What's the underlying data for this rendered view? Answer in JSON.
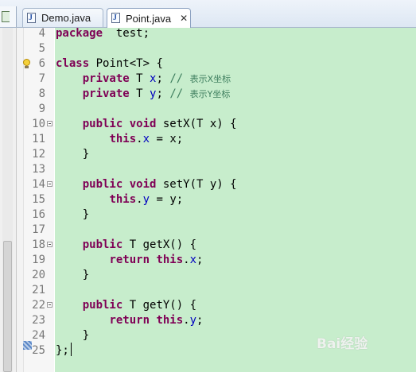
{
  "tabs": [
    {
      "label": "Demo.java",
      "icon": "java-file-icon",
      "active": false
    },
    {
      "label": "Point.java",
      "icon": "java-file-icon",
      "active": true,
      "close": "✕"
    }
  ],
  "editor": {
    "background": "#c7edcc",
    "lines": [
      {
        "num": "4",
        "code": [
          [
            "kw",
            "package"
          ],
          [
            "",
            "  test;"
          ]
        ]
      },
      {
        "num": "5",
        "code": []
      },
      {
        "num": "6",
        "code": [
          [
            "kw",
            "class"
          ],
          [
            "",
            " Point<T> {"
          ]
        ],
        "marker": "warning-bulb-icon"
      },
      {
        "num": "7",
        "code": [
          [
            "",
            "    "
          ],
          [
            "kw",
            "private"
          ],
          [
            "",
            " T "
          ],
          [
            "fld",
            "x"
          ],
          [
            "",
            "; "
          ],
          [
            "cm",
            "// "
          ],
          [
            "cmcn",
            "表示X坐标"
          ]
        ]
      },
      {
        "num": "8",
        "code": [
          [
            "",
            "    "
          ],
          [
            "kw",
            "private"
          ],
          [
            "",
            " T "
          ],
          [
            "fld",
            "y"
          ],
          [
            "",
            "; "
          ],
          [
            "cm",
            "// "
          ],
          [
            "cmcn",
            "表示Y坐标"
          ]
        ]
      },
      {
        "num": "9",
        "code": []
      },
      {
        "num": "10",
        "code": [
          [
            "",
            "    "
          ],
          [
            "kw",
            "public"
          ],
          [
            "",
            " "
          ],
          [
            "kw",
            "void"
          ],
          [
            "",
            " setX(T x) {"
          ]
        ],
        "fold": true
      },
      {
        "num": "11",
        "code": [
          [
            "",
            "        "
          ],
          [
            "kw",
            "this"
          ],
          [
            "",
            "."
          ],
          [
            "fld",
            "x"
          ],
          [
            "",
            " = x;"
          ]
        ]
      },
      {
        "num": "12",
        "code": [
          [
            "",
            "    }"
          ]
        ]
      },
      {
        "num": "13",
        "code": []
      },
      {
        "num": "14",
        "code": [
          [
            "",
            "    "
          ],
          [
            "kw",
            "public"
          ],
          [
            "",
            " "
          ],
          [
            "kw",
            "void"
          ],
          [
            "",
            " setY(T y) {"
          ]
        ],
        "fold": true
      },
      {
        "num": "15",
        "code": [
          [
            "",
            "        "
          ],
          [
            "kw",
            "this"
          ],
          [
            "",
            "."
          ],
          [
            "fld",
            "y"
          ],
          [
            "",
            " = y;"
          ]
        ]
      },
      {
        "num": "16",
        "code": [
          [
            "",
            "    }"
          ]
        ]
      },
      {
        "num": "17",
        "code": []
      },
      {
        "num": "18",
        "code": [
          [
            "",
            "    "
          ],
          [
            "kw",
            "public"
          ],
          [
            "",
            " T getX() {"
          ]
        ],
        "fold": true
      },
      {
        "num": "19",
        "code": [
          [
            "",
            "        "
          ],
          [
            "kw",
            "return"
          ],
          [
            "",
            " "
          ],
          [
            "kw",
            "this"
          ],
          [
            "",
            "."
          ],
          [
            "fld",
            "x"
          ],
          [
            "",
            ";"
          ]
        ]
      },
      {
        "num": "20",
        "code": [
          [
            "",
            "    }"
          ]
        ]
      },
      {
        "num": "21",
        "code": []
      },
      {
        "num": "22",
        "code": [
          [
            "",
            "    "
          ],
          [
            "kw",
            "public"
          ],
          [
            "",
            " T getY() {"
          ]
        ],
        "fold": true
      },
      {
        "num": "23",
        "code": [
          [
            "",
            "        "
          ],
          [
            "kw",
            "return"
          ],
          [
            "",
            " "
          ],
          [
            "kw",
            "this"
          ],
          [
            "",
            "."
          ],
          [
            "fld",
            "y"
          ],
          [
            "",
            ";"
          ]
        ]
      },
      {
        "num": "24",
        "code": [
          [
            "",
            "    }"
          ]
        ]
      },
      {
        "num": "25",
        "code": [
          [
            "",
            "};"
          ]
        ],
        "current": true
      }
    ]
  },
  "watermark": "Bai经验"
}
